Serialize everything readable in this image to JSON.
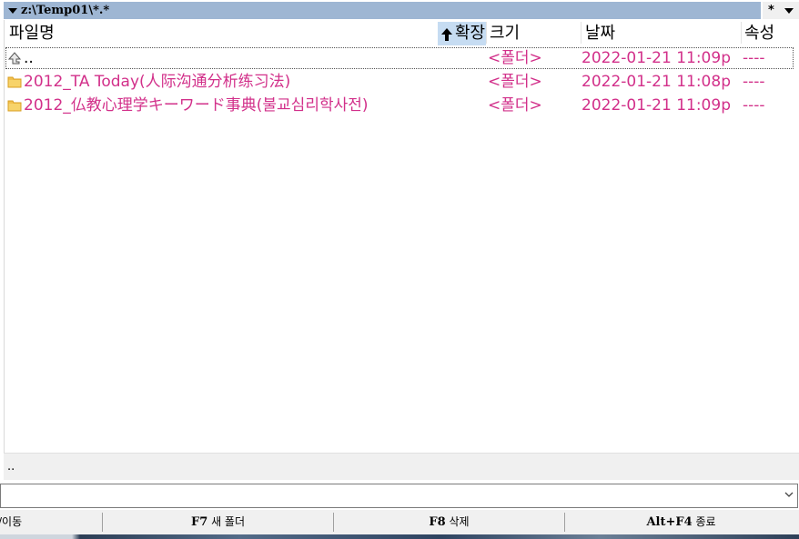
{
  "path_bar": {
    "path": "z:\\Temp01\\*.*",
    "filter": "*"
  },
  "columns": {
    "name": "파일명",
    "ext": "확장",
    "size": "크기",
    "date": "날짜",
    "attr": "속성"
  },
  "rows": [
    {
      "icon": "updir-icon",
      "name": "..",
      "size": "<폴더>",
      "date": "2022-01-21  11:09p",
      "attr": "----"
    },
    {
      "icon": "folder-icon",
      "name": "2012_TA Today(人际沟通分析练习法)",
      "size": "<폴더>",
      "date": "2022-01-21  11:08p",
      "attr": "----"
    },
    {
      "icon": "folder-icon",
      "name": "2012_仏教心理学キーワード事典(불교심리학사전)",
      "size": "<폴더>",
      "date": "2022-01-21  11:09p",
      "attr": "----"
    }
  ],
  "status": "..",
  "function_keys": {
    "k1": "/이동",
    "k2_key": "F7",
    "k2_label": "새 폴더",
    "k3_key": "F8",
    "k3_label": "삭제",
    "k4_key": "Alt+F4",
    "k4_label": "종료"
  },
  "colors": {
    "folder_text": "#d2308a",
    "path_bar_bg": "#9eb6d3",
    "sorted_column_bg": "#c6dcf2",
    "folder_icon": "#f2c14e"
  }
}
